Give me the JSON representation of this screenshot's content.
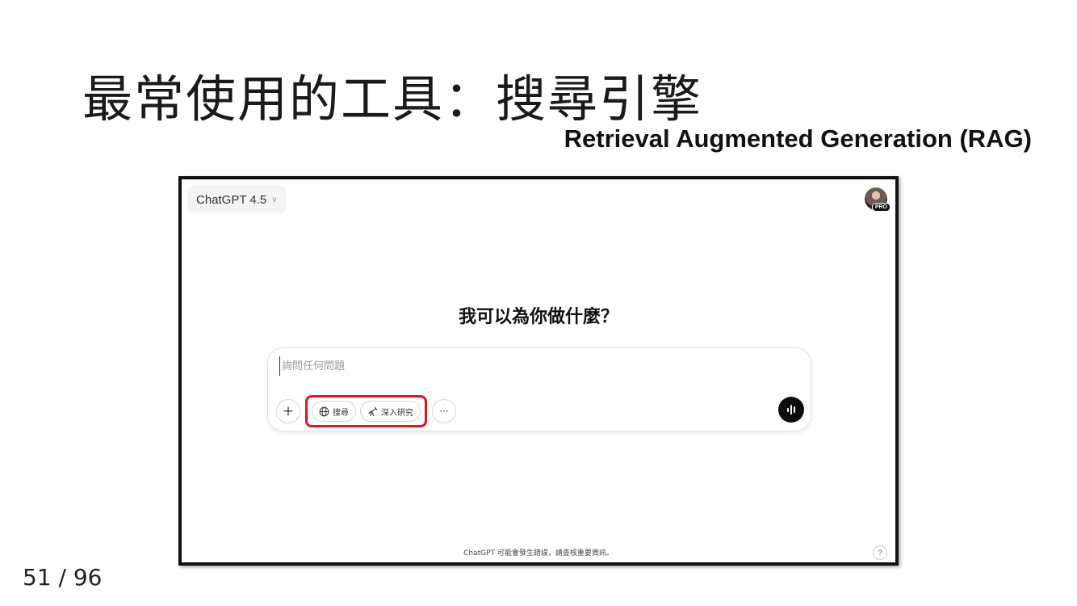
{
  "slide": {
    "title": "最常使用的工具：搜尋引擎",
    "subtitle": "Retrieval Augmented Generation (RAG)",
    "page_number": "51 / 96"
  },
  "app": {
    "model_selector": {
      "label": "ChatGPT 4.5",
      "icon": "chevron-down-icon"
    },
    "avatar": {
      "badge": "PRO"
    },
    "heading": "我可以為你做什麼？",
    "composer": {
      "placeholder": "詢問任何問題",
      "value": "",
      "buttons": {
        "add": "+",
        "search": {
          "label": "搜尋",
          "icon": "globe-icon"
        },
        "deep_research": {
          "label": "深入研究",
          "icon": "telescope-icon"
        },
        "more": "···",
        "voice": {
          "icon": "voice-waveform-icon"
        }
      },
      "highlight_color": "#e3141b"
    },
    "footer_note": "ChatGPT 可能會發生錯誤，請查核重要資訊。",
    "help": "?"
  }
}
